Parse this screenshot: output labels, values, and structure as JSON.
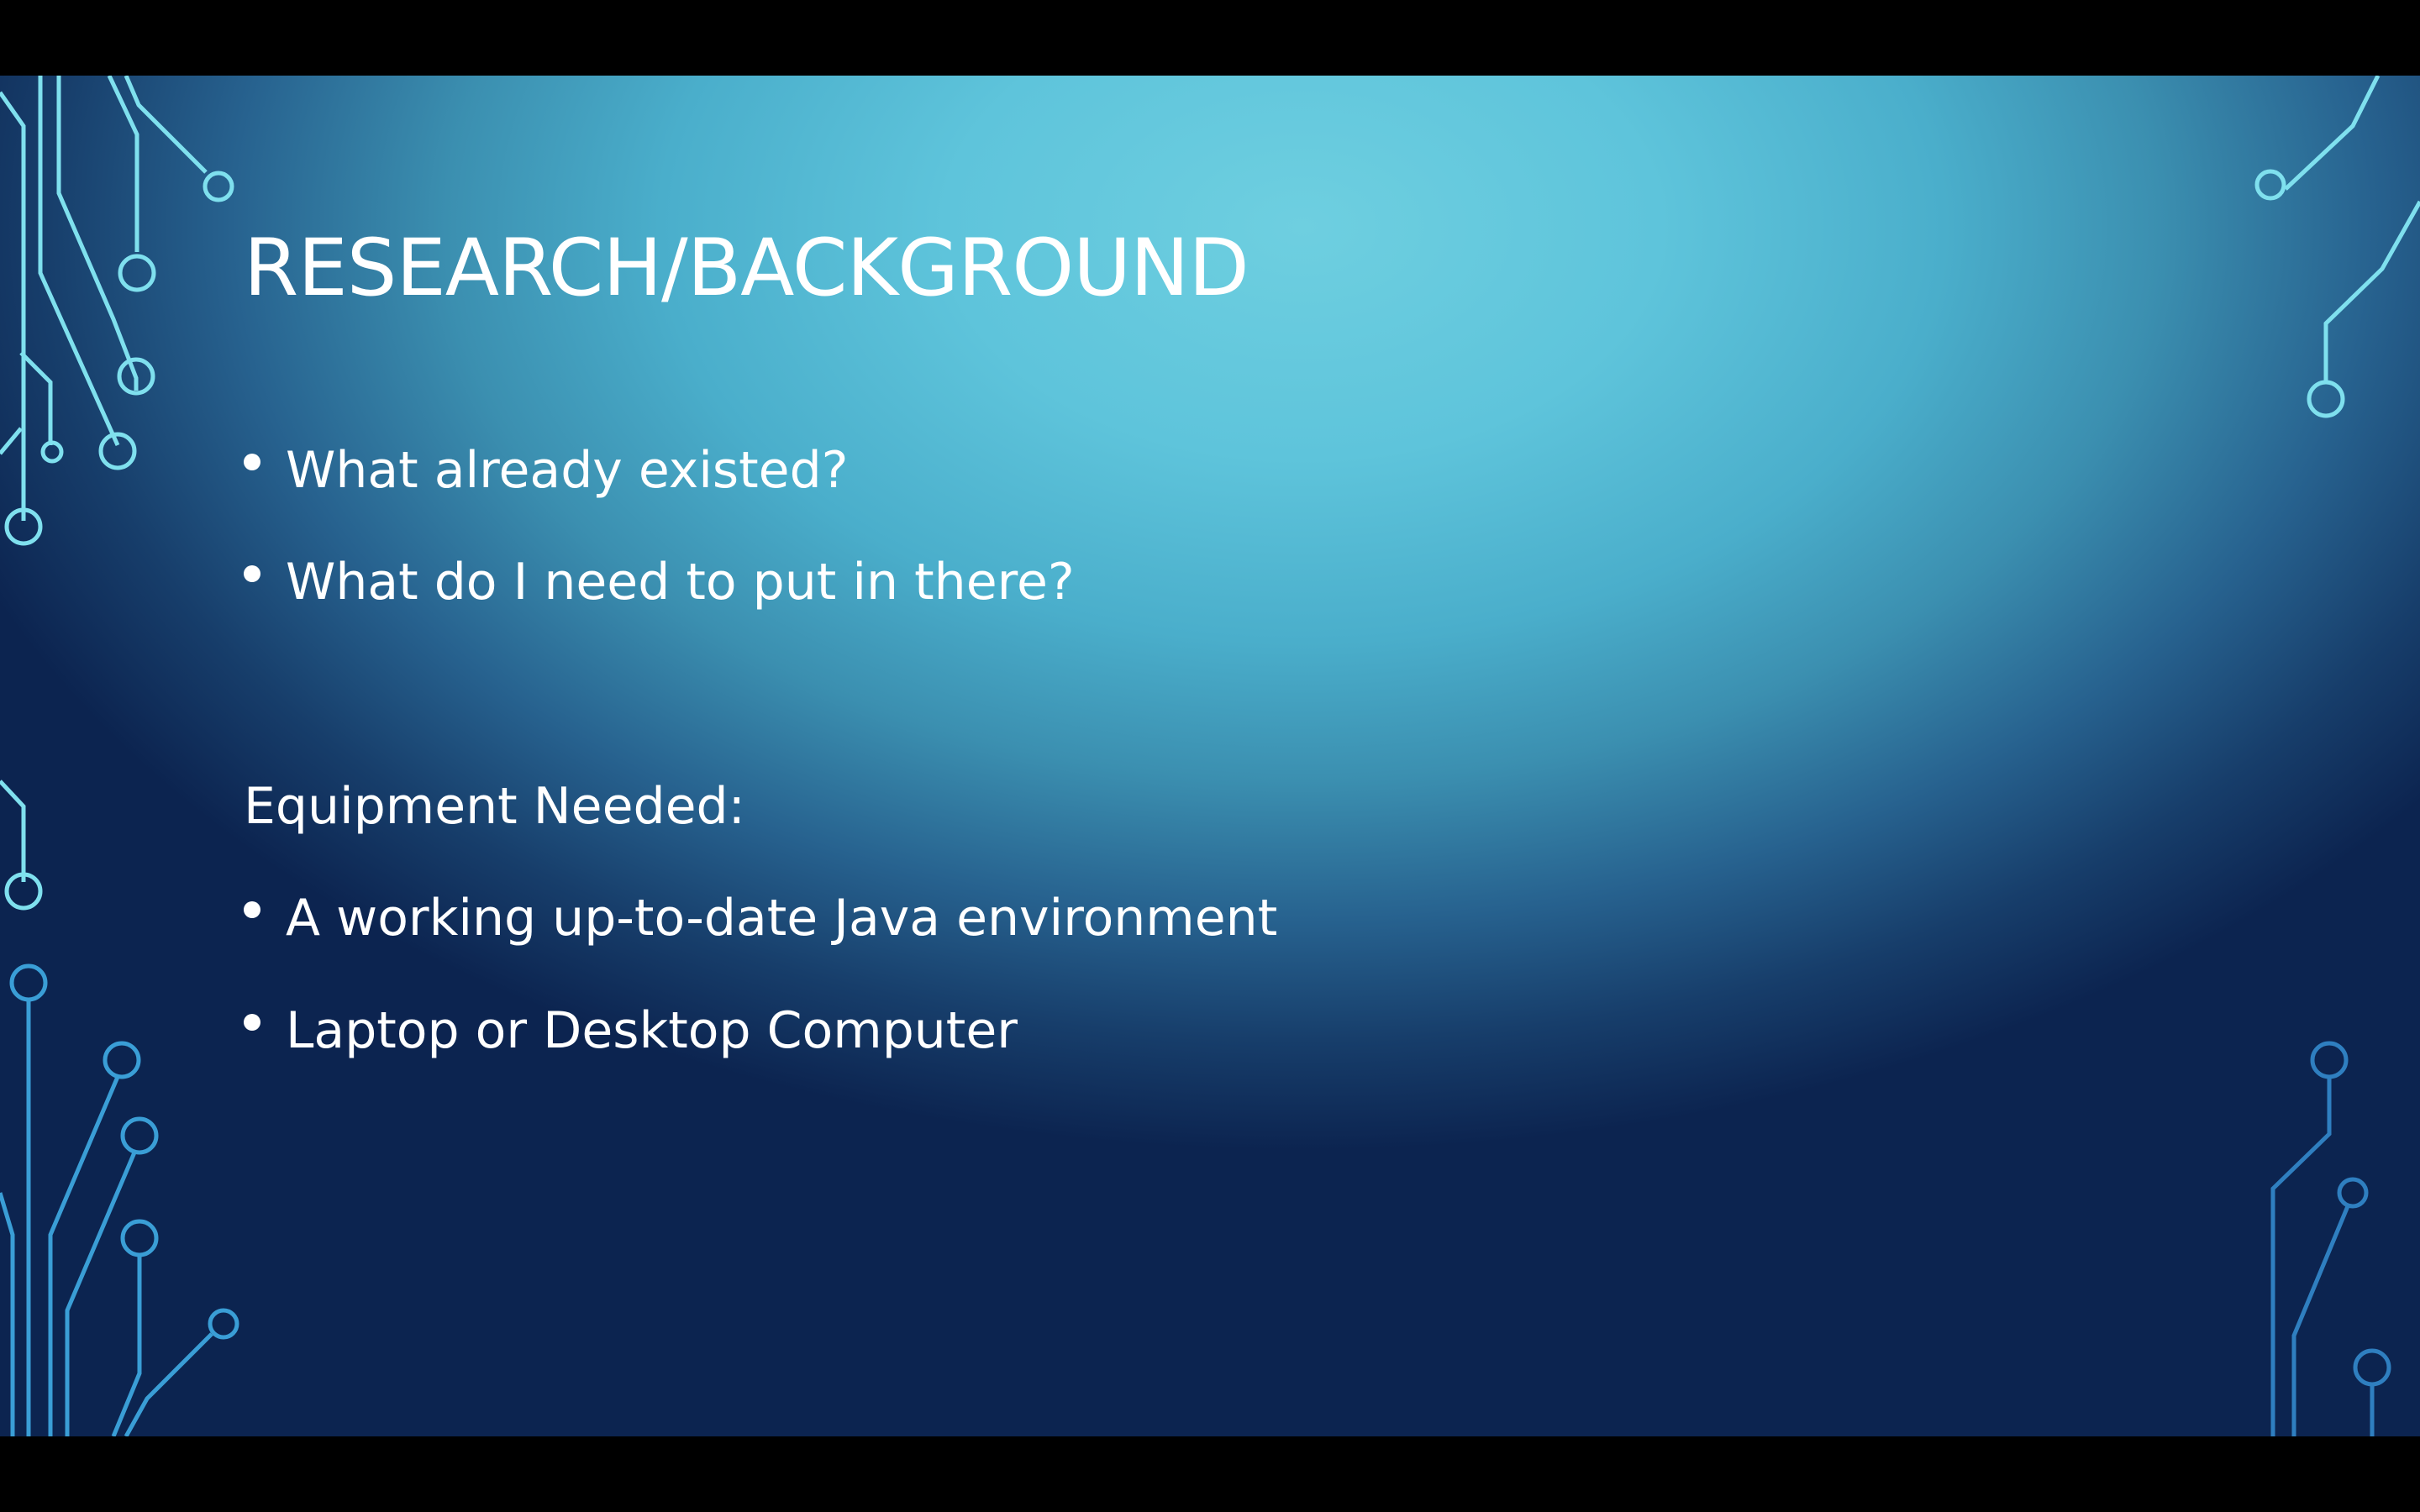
{
  "slide": {
    "title": "RESEARCH/BACKGROUND",
    "bullets_top": [
      "What already existed?",
      "What do I need to put in there?"
    ],
    "subheading": "Equipment Needed:",
    "bullets_bottom": [
      "A working up-to-date Java environment",
      "Laptop or Desktop Computer"
    ]
  },
  "colors": {
    "background_light": "#6ecfe0",
    "background_dark": "#0c2450",
    "circuit_light": "#7fe0ee",
    "circuit_dark": "#3a9ed6",
    "text": "#ffffff"
  },
  "icons": {
    "decoration": "circuit-lines-decoration"
  }
}
